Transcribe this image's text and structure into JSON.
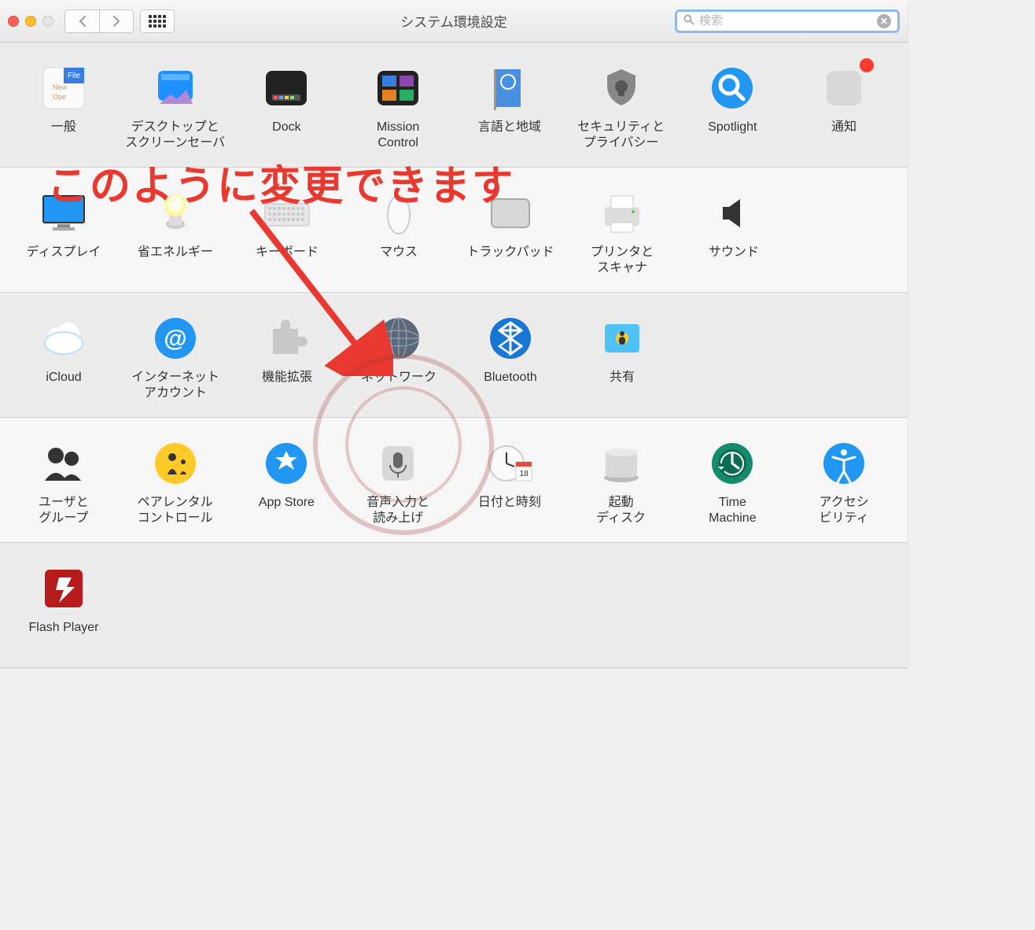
{
  "window": {
    "title": "システム環境設定"
  },
  "search": {
    "placeholder": "検索"
  },
  "annotation": {
    "text": "このように変更できます"
  },
  "rows": [
    [
      {
        "label": "一般",
        "icon": "general"
      },
      {
        "label": "デスクトップと\nスクリーンセーバ",
        "icon": "desktop"
      },
      {
        "label": "Dock",
        "icon": "dock"
      },
      {
        "label": "Mission\nControl",
        "icon": "mission"
      },
      {
        "label": "言語と地域",
        "icon": "language"
      },
      {
        "label": "セキュリティと\nプライバシー",
        "icon": "security"
      },
      {
        "label": "Spotlight",
        "icon": "spotlight"
      },
      {
        "label": "通知",
        "icon": "notifications",
        "badge": true
      }
    ],
    [
      {
        "label": "ディスプレイ",
        "icon": "displays"
      },
      {
        "label": "省エネルギー",
        "icon": "energy"
      },
      {
        "label": "キーボード",
        "icon": "keyboard"
      },
      {
        "label": "マウス",
        "icon": "mouse"
      },
      {
        "label": "トラックパッド",
        "icon": "trackpad"
      },
      {
        "label": "プリンタと\nスキャナ",
        "icon": "printers"
      },
      {
        "label": "サウンド",
        "icon": "sound"
      }
    ],
    [
      {
        "label": "iCloud",
        "icon": "icloud"
      },
      {
        "label": "インターネット\nアカウント",
        "icon": "internet"
      },
      {
        "label": "機能拡張",
        "icon": "extensions"
      },
      {
        "label": "ネットワーク",
        "icon": "network"
      },
      {
        "label": "Bluetooth",
        "icon": "bluetooth"
      },
      {
        "label": "共有",
        "icon": "sharing"
      }
    ],
    [
      {
        "label": "ユーザと\nグループ",
        "icon": "users"
      },
      {
        "label": "ペアレンタル\nコントロール",
        "icon": "parental"
      },
      {
        "label": "App Store",
        "icon": "appstore"
      },
      {
        "label": "音声入力と\n読み上げ",
        "icon": "dictation"
      },
      {
        "label": "日付と時刻",
        "icon": "datetime"
      },
      {
        "label": "起動\nディスク",
        "icon": "startup"
      },
      {
        "label": "Time\nMachine",
        "icon": "timemachine"
      },
      {
        "label": "アクセシ\nビリティ",
        "icon": "accessibility"
      }
    ],
    [
      {
        "label": "Flash Player",
        "icon": "flash"
      }
    ]
  ]
}
